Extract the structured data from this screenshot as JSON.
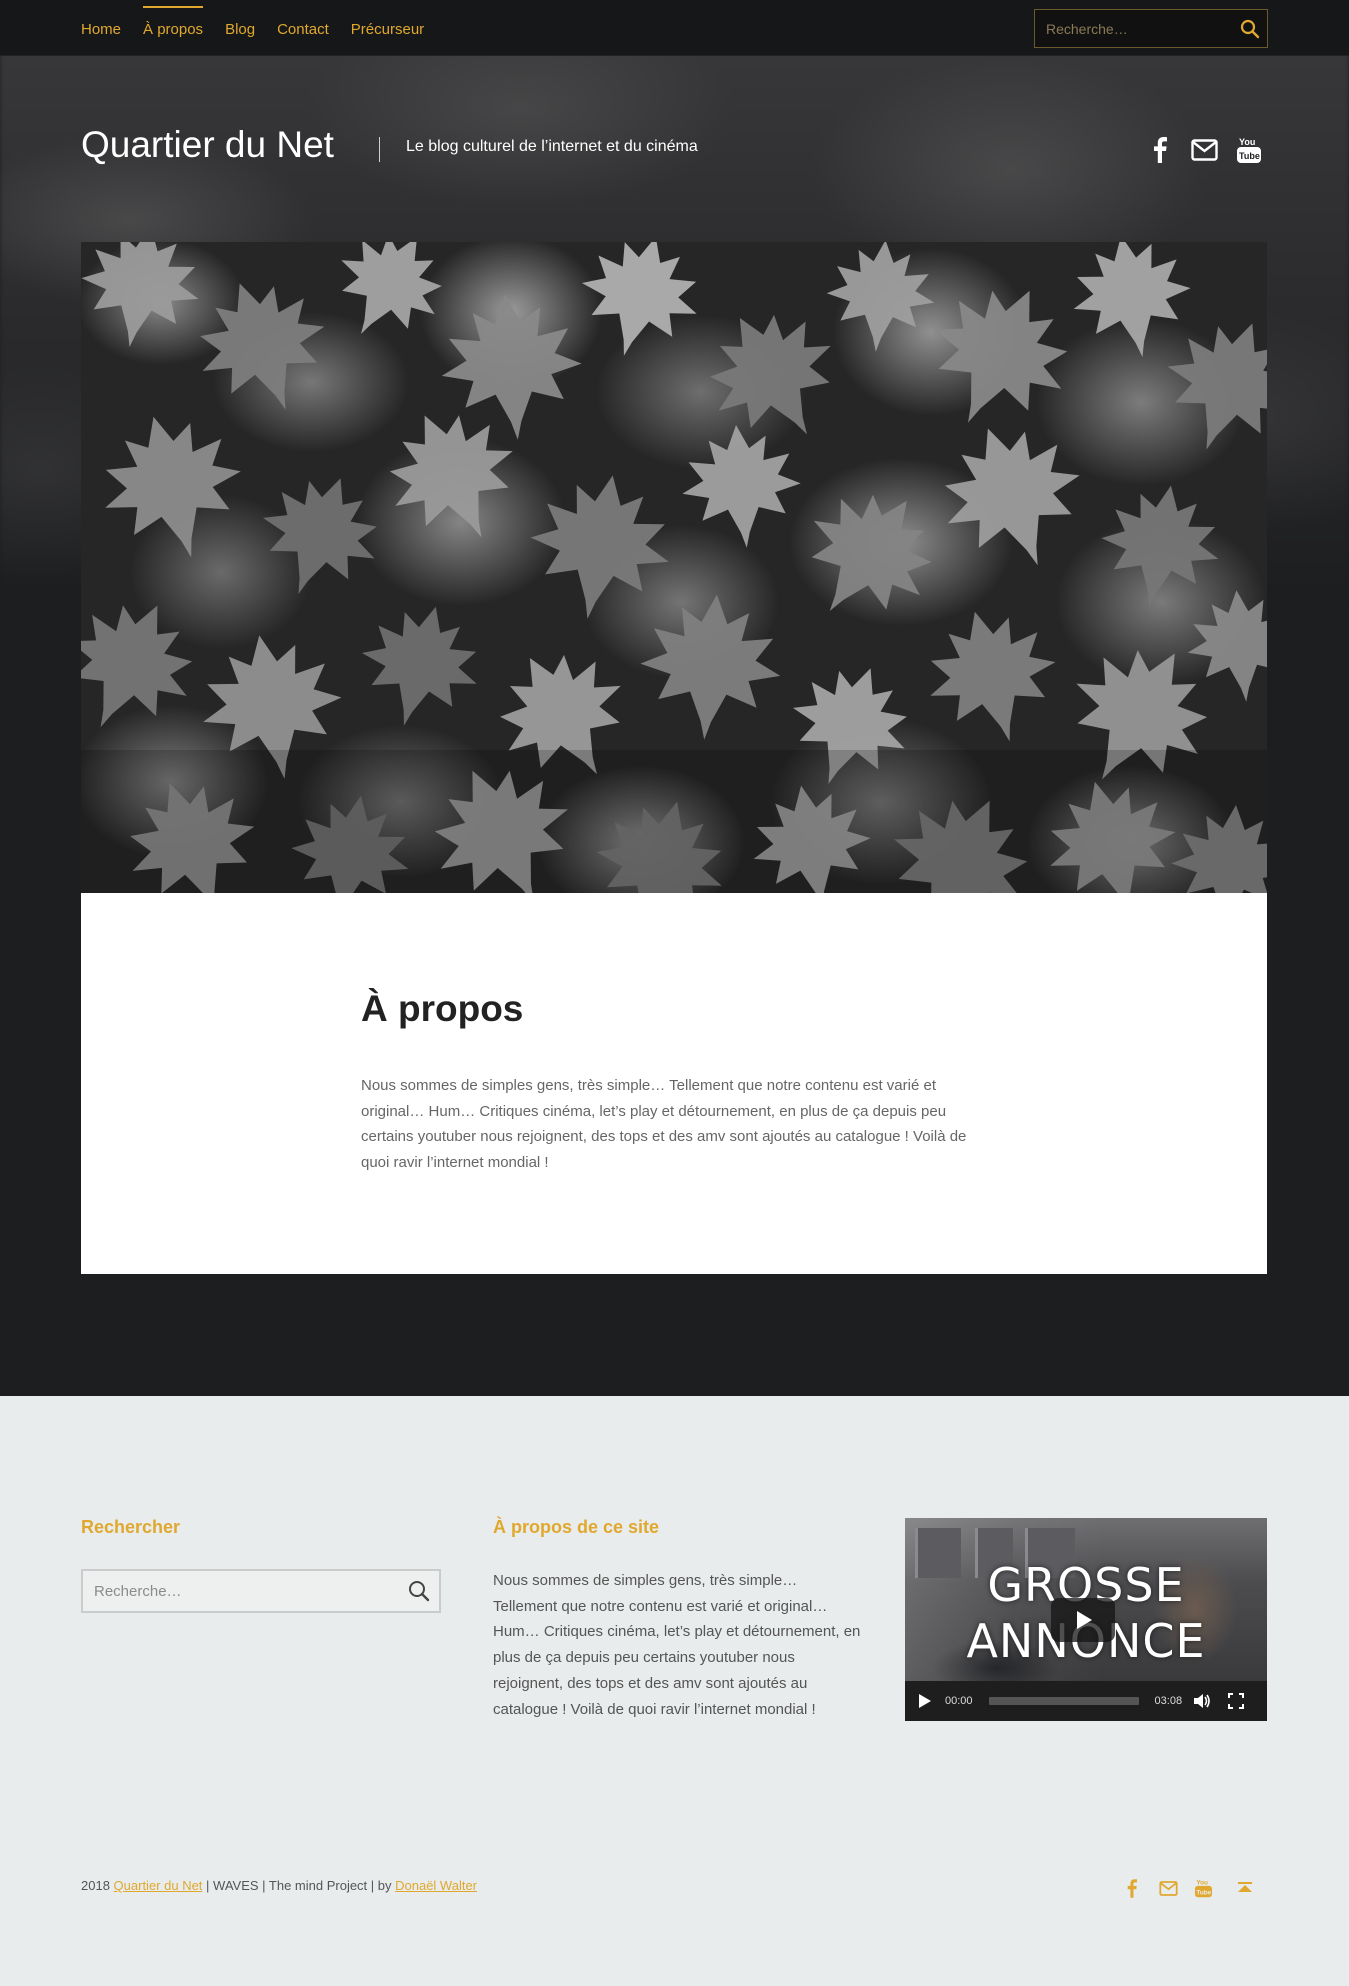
{
  "nav": {
    "items": [
      {
        "label": "Home"
      },
      {
        "label": "À propos",
        "active": true
      },
      {
        "label": "Blog"
      },
      {
        "label": "Contact"
      },
      {
        "label": "Précurseur"
      }
    ],
    "search_placeholder": "Recherche…",
    "search_icon": "search-icon"
  },
  "header": {
    "site_title": "Quartier du Net",
    "tagline": "Le blog culturel de l’internet et du cinéma",
    "social_icons": [
      "facebook-icon",
      "mail-icon",
      "youtube-icon"
    ]
  },
  "page": {
    "title": "À propos",
    "body": "Nous sommes de simples gens, très simple… Tellement que notre contenu est varié et original… Hum… Critiques cinéma, let’s play et détournement, en plus de ça depuis peu certains youtuber nous rejoignent, des tops et des amv sont ajoutés au catalogue ! Voilà de quoi ravir l’internet mondial !"
  },
  "footer": {
    "search_widget": {
      "title": "Rechercher",
      "placeholder": "Recherche…"
    },
    "about_widget": {
      "title": "À propos de ce site",
      "text": "Nous sommes de simples gens, très simple… Tellement que notre contenu est varié et original… Hum… Critiques cinéma, let’s play et détournement, en plus de ça depuis peu certains youtuber nous rejoignent, des tops et des amv sont ajoutés au catalogue ! Voilà de quoi ravir l’internet mondial !"
    },
    "video_widget": {
      "overlay_line1": "GROSSE",
      "overlay_line2": "ANNONCE",
      "current_time": "00:00",
      "duration": "03:08",
      "progress": 0
    },
    "credits": {
      "year": "2018",
      "site_link": "Quartier du Net",
      "middle": "| WAVES | The mind Project | by",
      "author_link": "Donaël Walter"
    },
    "icons": [
      "facebook-icon",
      "mail-icon",
      "youtube-icon",
      "back-to-top-icon"
    ]
  },
  "colors": {
    "accent": "#e0a82e",
    "dark_bg": "#1d1e20",
    "topbar_bg": "#161718",
    "light_bg": "#e9ecec",
    "card_bg": "#ffffff"
  }
}
